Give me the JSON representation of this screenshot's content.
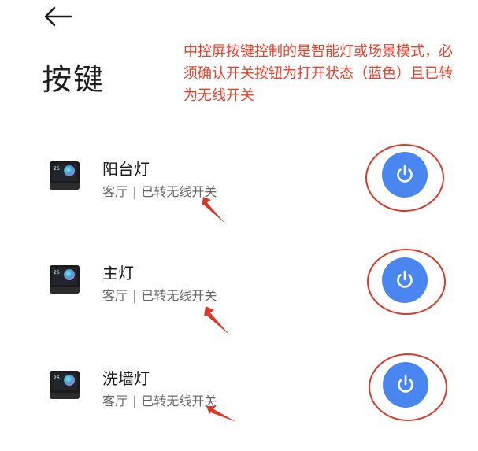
{
  "header": {
    "back_icon": "arrow-left-icon",
    "title": "按键"
  },
  "annotation": {
    "note": "中控屏按键控制的是智能灯或场景模式，必须确认开关按钮为打开状态（蓝色）且已转为无线开关",
    "color": "#e8412c"
  },
  "devices": [
    {
      "name": "阳台灯",
      "room": "客厅",
      "separator": "|",
      "mode": "已转无线开关",
      "thumb_clock": "26",
      "power_icon": "power-icon",
      "power_on": true
    },
    {
      "name": "主灯",
      "room": "客厅",
      "separator": "|",
      "mode": "已转无线开关",
      "thumb_clock": "26",
      "power_icon": "power-icon",
      "power_on": true
    },
    {
      "name": "洗墙灯",
      "room": "客厅",
      "separator": "|",
      "mode": "已转无线开关",
      "thumb_clock": "26",
      "power_icon": "power-icon",
      "power_on": true
    }
  ],
  "colors": {
    "power_on": "#4a86ef",
    "annotation_red": "#d83a2a"
  }
}
